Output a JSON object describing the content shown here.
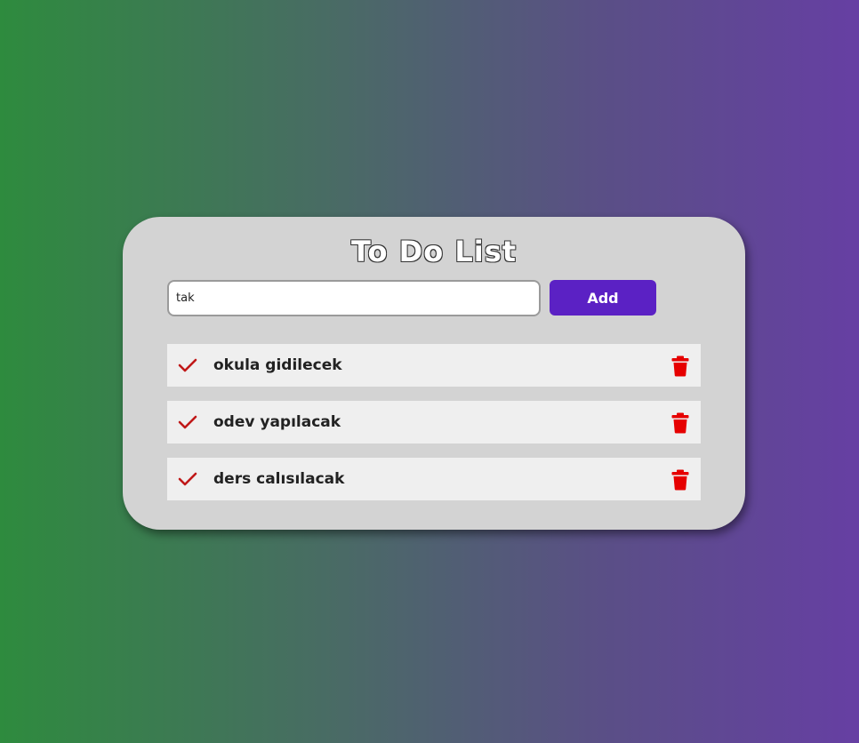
{
  "app": {
    "title": "To Do List"
  },
  "input": {
    "value": "tak",
    "placeholder": ""
  },
  "add_button": {
    "label": "Add"
  },
  "todos": [
    {
      "text": "okula gidilecek"
    },
    {
      "text": "odev yapılacak"
    },
    {
      "text": "ders calısılacak"
    }
  ],
  "icons": {
    "check": "check-icon",
    "delete": "trash-icon"
  },
  "colors": {
    "accent": "#5b21c4",
    "check": "#c01818",
    "delete": "#e60000",
    "card": "#d3d3d3",
    "item_bg": "#efefef"
  }
}
